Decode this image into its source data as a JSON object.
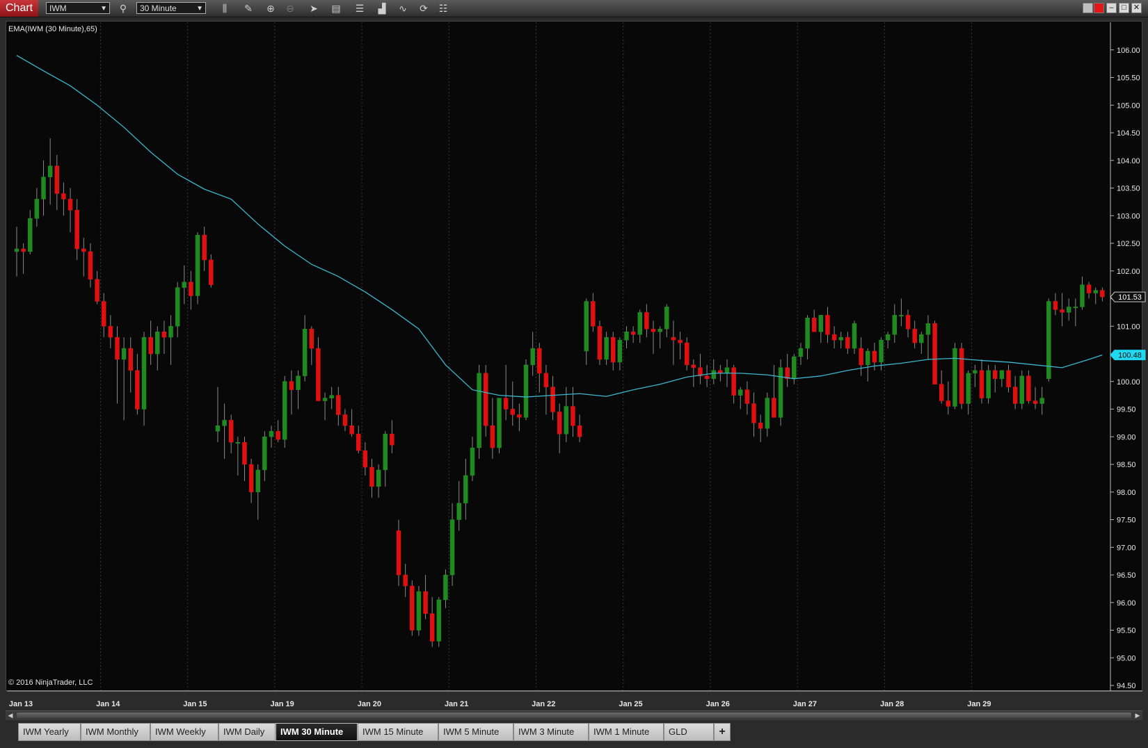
{
  "titlebar": {
    "app_title": "Chart",
    "instrument": "IWM",
    "period": "30 Minute",
    "tools": [
      "bar-type-icon",
      "pencil-icon",
      "zoom-in-icon",
      "zoom-out-icon",
      "pointer-icon",
      "data-box-icon",
      "properties-icon",
      "strategies-icon",
      "drawing-tools-icon",
      "reload-icon",
      "list-icon"
    ],
    "window_buttons": [
      "minimize-icon",
      "maximize-icon",
      "close-icon"
    ]
  },
  "indicator_label": "EMA(IWM (30 Minute),65)",
  "copyright": "© 2016 NinjaTrader, LLC",
  "price_markers": {
    "last": "101.53",
    "ema": "100.48"
  },
  "colors": {
    "up": "#1f8a1f",
    "down": "#e01010",
    "ema": "#3ab8d0",
    "marker_last_bg": "#101010",
    "marker_ema_bg": "#20d8f0"
  },
  "chart_data": {
    "type": "candlestick",
    "y_ticks": [
      "106.00",
      "105.50",
      "105.00",
      "104.50",
      "104.00",
      "103.50",
      "103.00",
      "102.50",
      "102.00",
      "101.50",
      "101.00",
      "100.50",
      "100.00",
      "99.50",
      "99.00",
      "98.50",
      "98.00",
      "97.50",
      "97.00",
      "96.50",
      "96.00",
      "95.50",
      "95.00",
      "94.50"
    ],
    "ylim": [
      94.4,
      106.5
    ],
    "x_ticks": [
      "Jan 13",
      "Jan 14",
      "Jan 15",
      "Jan 19",
      "Jan 20",
      "Jan 21",
      "Jan 22",
      "Jan 25",
      "Jan 26",
      "Jan 27",
      "Jan 28",
      "Jan 29"
    ],
    "bars_per_day": 13,
    "total_bars": 163,
    "ohlc": [
      [
        102.35,
        102.8,
        101.9,
        102.4
      ],
      [
        102.4,
        102.5,
        101.95,
        102.35
      ],
      [
        102.35,
        103.1,
        102.3,
        102.95
      ],
      [
        102.95,
        103.5,
        102.8,
        103.3
      ],
      [
        103.3,
        104.0,
        103.0,
        103.7
      ],
      [
        103.7,
        104.4,
        103.2,
        103.9
      ],
      [
        103.9,
        104.1,
        103.1,
        103.4
      ],
      [
        103.4,
        103.6,
        103.0,
        103.3
      ],
      [
        103.3,
        103.5,
        102.7,
        103.1
      ],
      [
        103.1,
        103.3,
        102.2,
        102.4
      ],
      [
        102.4,
        102.6,
        101.9,
        102.35
      ],
      [
        102.35,
        102.5,
        101.7,
        101.85
      ],
      [
        101.85,
        102.0,
        101.4,
        101.45
      ],
      [
        101.45,
        101.6,
        100.8,
        101.0
      ],
      [
        101.0,
        101.2,
        100.6,
        100.8
      ],
      [
        100.8,
        101.0,
        99.6,
        100.4
      ],
      [
        100.4,
        100.8,
        99.3,
        100.6
      ],
      [
        100.6,
        100.8,
        99.8,
        100.2
      ],
      [
        100.2,
        100.5,
        99.4,
        99.5
      ],
      [
        99.5,
        100.9,
        99.2,
        100.8
      ],
      [
        100.8,
        101.1,
        100.3,
        100.5
      ],
      [
        100.5,
        101.0,
        100.2,
        100.9
      ],
      [
        100.9,
        101.1,
        100.5,
        100.8
      ],
      [
        100.8,
        101.2,
        100.3,
        101.0
      ],
      [
        101.0,
        101.8,
        100.8,
        101.7
      ],
      [
        101.7,
        102.1,
        101.4,
        101.8
      ],
      [
        101.8,
        102.0,
        101.3,
        101.55
      ],
      [
        101.55,
        102.7,
        101.4,
        102.65
      ],
      [
        102.65,
        102.8,
        102.0,
        102.2
      ],
      [
        102.2,
        102.3,
        101.7,
        101.75
      ],
      [
        99.1,
        99.9,
        98.9,
        99.2
      ],
      [
        99.2,
        99.6,
        98.6,
        99.3
      ],
      [
        99.3,
        99.4,
        98.7,
        98.9
      ],
      [
        98.9,
        99.0,
        98.3,
        98.9
      ],
      [
        98.9,
        99.0,
        98.2,
        98.5
      ],
      [
        98.5,
        98.6,
        97.8,
        98.0
      ],
      [
        98.0,
        98.5,
        97.5,
        98.4
      ],
      [
        98.4,
        99.1,
        98.2,
        99.0
      ],
      [
        99.0,
        99.2,
        98.8,
        99.1
      ],
      [
        99.1,
        99.3,
        98.9,
        98.95
      ],
      [
        98.95,
        100.1,
        98.8,
        100.0
      ],
      [
        100.0,
        100.2,
        99.4,
        99.85
      ],
      [
        99.85,
        100.2,
        99.5,
        100.1
      ],
      [
        100.1,
        101.2,
        100.0,
        100.95
      ],
      [
        100.95,
        101.0,
        100.3,
        100.6
      ],
      [
        100.6,
        100.8,
        99.8,
        99.65
      ],
      [
        99.65,
        99.8,
        99.3,
        99.7
      ],
      [
        99.7,
        99.9,
        99.5,
        99.75
      ],
      [
        99.75,
        99.9,
        99.2,
        99.4
      ],
      [
        99.4,
        99.5,
        99.1,
        99.2
      ],
      [
        99.2,
        99.5,
        99.0,
        99.05
      ],
      [
        99.05,
        99.2,
        98.7,
        98.75
      ],
      [
        98.75,
        98.9,
        98.3,
        98.45
      ],
      [
        98.45,
        98.6,
        97.9,
        98.1
      ],
      [
        98.1,
        98.5,
        97.9,
        98.4
      ],
      [
        98.4,
        99.1,
        98.1,
        99.05
      ],
      [
        99.05,
        99.3,
        98.7,
        98.85
      ],
      [
        97.3,
        97.5,
        96.3,
        96.5
      ],
      [
        96.5,
        96.7,
        96.1,
        96.3
      ],
      [
        96.3,
        96.4,
        95.4,
        95.5
      ],
      [
        95.5,
        96.3,
        95.4,
        96.2
      ],
      [
        96.2,
        96.5,
        95.7,
        95.8
      ],
      [
        95.8,
        96.1,
        95.2,
        95.3
      ],
      [
        95.3,
        96.1,
        95.2,
        96.05
      ],
      [
        96.05,
        96.6,
        95.9,
        96.5
      ],
      [
        96.5,
        97.8,
        96.3,
        97.5
      ],
      [
        97.5,
        98.2,
        97.3,
        97.8
      ],
      [
        97.8,
        98.6,
        97.5,
        98.3
      ],
      [
        98.3,
        99.0,
        98.2,
        98.8
      ],
      [
        98.8,
        100.3,
        98.6,
        100.15
      ],
      [
        100.15,
        100.3,
        99.0,
        99.2
      ],
      [
        99.2,
        99.7,
        98.6,
        98.8
      ],
      [
        98.8,
        99.6,
        98.7,
        99.7
      ],
      [
        99.7,
        100.3,
        99.3,
        99.5
      ],
      [
        99.5,
        100.0,
        99.2,
        99.4
      ],
      [
        99.4,
        99.6,
        99.1,
        99.35
      ],
      [
        99.35,
        100.4,
        99.3,
        100.3
      ],
      [
        100.3,
        100.9,
        100.1,
        100.6
      ],
      [
        100.6,
        100.7,
        99.8,
        100.15
      ],
      [
        100.15,
        100.3,
        99.4,
        99.9
      ],
      [
        99.9,
        100.1,
        99.3,
        99.45
      ],
      [
        99.45,
        99.6,
        98.7,
        99.05
      ],
      [
        99.05,
        99.9,
        98.9,
        99.55
      ],
      [
        99.55,
        99.9,
        99.0,
        99.2
      ],
      [
        99.2,
        99.4,
        98.9,
        99.0
      ],
      [
        100.55,
        101.5,
        100.3,
        101.45
      ],
      [
        101.45,
        101.6,
        100.9,
        101.0
      ],
      [
        101.0,
        101.1,
        100.3,
        100.4
      ],
      [
        100.4,
        100.9,
        100.3,
        100.8
      ],
      [
        100.8,
        100.9,
        100.2,
        100.35
      ],
      [
        100.35,
        100.8,
        100.2,
        100.75
      ],
      [
        100.75,
        101.0,
        100.6,
        100.9
      ],
      [
        100.9,
        101.0,
        100.7,
        100.85
      ],
      [
        100.85,
        101.3,
        100.7,
        101.25
      ],
      [
        101.25,
        101.4,
        100.8,
        100.95
      ],
      [
        100.95,
        101.1,
        100.5,
        100.9
      ],
      [
        100.9,
        101.0,
        100.6,
        100.95
      ],
      [
        100.95,
        101.4,
        100.8,
        101.35
      ],
      [
        100.8,
        101.1,
        100.3,
        100.75
      ],
      [
        100.75,
        100.9,
        100.4,
        100.7
      ],
      [
        100.7,
        100.8,
        100.2,
        100.3
      ],
      [
        100.3,
        100.4,
        99.9,
        100.25
      ],
      [
        100.25,
        100.5,
        99.95,
        100.1
      ],
      [
        100.1,
        100.3,
        99.9,
        100.05
      ],
      [
        100.05,
        100.4,
        99.95,
        100.2
      ],
      [
        100.2,
        100.3,
        100.0,
        100.15
      ],
      [
        100.15,
        100.4,
        99.9,
        100.25
      ],
      [
        100.25,
        100.3,
        99.6,
        99.75
      ],
      [
        99.75,
        99.9,
        99.5,
        99.85
      ],
      [
        99.85,
        100.0,
        99.4,
        99.6
      ],
      [
        99.6,
        99.8,
        99.0,
        99.25
      ],
      [
        99.25,
        99.4,
        98.9,
        99.15
      ],
      [
        99.15,
        99.8,
        99.0,
        99.7
      ],
      [
        99.7,
        100.3,
        99.6,
        99.35
      ],
      [
        99.35,
        100.4,
        99.2,
        100.25
      ],
      [
        100.25,
        100.5,
        99.9,
        100.05
      ],
      [
        100.05,
        100.5,
        99.95,
        100.45
      ],
      [
        100.45,
        100.7,
        100.3,
        100.6
      ],
      [
        100.6,
        101.2,
        100.4,
        101.15
      ],
      [
        101.15,
        101.3,
        100.9,
        100.9
      ],
      [
        100.9,
        101.2,
        100.7,
        101.2
      ],
      [
        101.2,
        101.35,
        100.7,
        100.85
      ],
      [
        100.85,
        101.0,
        100.6,
        100.75
      ],
      [
        100.75,
        100.9,
        100.6,
        100.8
      ],
      [
        100.8,
        100.9,
        100.5,
        100.6
      ],
      [
        100.6,
        101.1,
        100.5,
        101.05
      ],
      [
        100.6,
        100.8,
        100.1,
        100.3
      ],
      [
        100.3,
        100.6,
        100.0,
        100.55
      ],
      [
        100.55,
        100.7,
        100.2,
        100.35
      ],
      [
        100.35,
        100.8,
        100.2,
        100.75
      ],
      [
        100.75,
        100.9,
        100.6,
        100.85
      ],
      [
        100.85,
        101.4,
        100.7,
        101.2
      ],
      [
        101.2,
        101.5,
        101.0,
        101.2
      ],
      [
        101.2,
        101.3,
        100.8,
        100.95
      ],
      [
        100.95,
        101.1,
        100.6,
        100.7
      ],
      [
        100.7,
        100.9,
        100.5,
        100.85
      ],
      [
        100.85,
        101.2,
        100.4,
        101.05
      ],
      [
        101.05,
        101.1,
        100.0,
        99.95
      ],
      [
        99.95,
        100.2,
        99.6,
        99.65
      ],
      [
        99.65,
        100.0,
        99.4,
        99.55
      ],
      [
        99.55,
        100.7,
        99.5,
        100.6
      ],
      [
        100.6,
        100.7,
        99.5,
        99.6
      ],
      [
        99.6,
        100.2,
        99.4,
        100.15
      ],
      [
        100.15,
        100.3,
        99.9,
        100.2
      ],
      [
        100.2,
        100.4,
        99.6,
        99.7
      ],
      [
        99.7,
        100.3,
        99.6,
        100.2
      ],
      [
        100.2,
        100.3,
        99.8,
        100.05
      ],
      [
        100.05,
        100.2,
        99.9,
        100.2
      ],
      [
        100.2,
        100.3,
        99.8,
        99.9
      ],
      [
        99.9,
        100.1,
        99.5,
        99.6
      ],
      [
        99.6,
        100.2,
        99.5,
        100.1
      ],
      [
        100.1,
        100.2,
        99.6,
        99.65
      ],
      [
        99.65,
        99.9,
        99.5,
        99.6
      ],
      [
        99.6,
        99.9,
        99.4,
        99.7
      ],
      [
        100.05,
        101.5,
        100.0,
        101.45
      ],
      [
        101.45,
        101.6,
        101.2,
        101.3
      ],
      [
        101.3,
        101.6,
        101.0,
        101.25
      ],
      [
        101.25,
        101.5,
        101.1,
        101.35
      ],
      [
        101.35,
        101.5,
        101.0,
        101.35
      ],
      [
        101.35,
        101.9,
        101.3,
        101.75
      ],
      [
        101.75,
        101.8,
        101.5,
        101.6
      ],
      [
        101.6,
        101.7,
        101.4,
        101.65
      ],
      [
        101.65,
        101.7,
        101.45,
        101.53
      ]
    ],
    "ema_x": [
      0,
      4,
      8,
      12,
      16,
      20,
      24,
      28,
      32,
      36,
      40,
      44,
      48,
      52,
      56,
      60,
      64,
      68,
      72,
      76,
      80,
      84,
      88,
      92,
      96,
      100,
      104,
      108,
      112,
      116,
      120,
      124,
      128,
      132,
      136,
      140,
      144,
      148,
      152,
      156,
      160,
      162
    ],
    "ema": [
      105.9,
      105.62,
      105.35,
      105.0,
      104.6,
      104.15,
      103.75,
      103.48,
      103.3,
      102.85,
      102.45,
      102.12,
      101.9,
      101.62,
      101.3,
      100.95,
      100.3,
      99.85,
      99.75,
      99.72,
      99.75,
      99.78,
      99.73,
      99.85,
      99.95,
      100.08,
      100.15,
      100.15,
      100.12,
      100.05,
      100.1,
      100.2,
      100.28,
      100.33,
      100.4,
      100.42,
      100.38,
      100.35,
      100.3,
      100.25,
      100.4,
      100.48
    ]
  },
  "tabs": [
    {
      "label": "IWM Yearly"
    },
    {
      "label": "IWM Monthly"
    },
    {
      "label": "IWM Weekly"
    },
    {
      "label": "IWM Daily"
    },
    {
      "label": "IWM 30 Minute",
      "active": true
    },
    {
      "label": "IWM 15 Minute"
    },
    {
      "label": "IWM 5 Minute"
    },
    {
      "label": "IWM 3 Minute"
    },
    {
      "label": "IWM 1 Minute"
    },
    {
      "label": "GLD"
    },
    {
      "label": "+"
    }
  ]
}
